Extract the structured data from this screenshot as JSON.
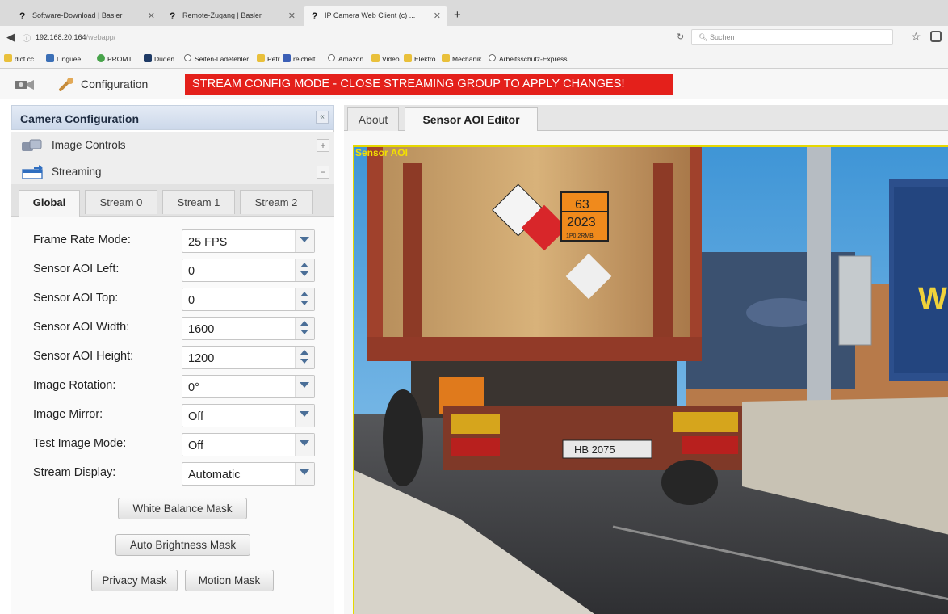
{
  "browser": {
    "tabs": [
      {
        "label": "Software-Download | Basler",
        "active": false
      },
      {
        "label": "Remote-Zugang | Basler",
        "active": false
      },
      {
        "label": "IP Camera Web Client (c) ...",
        "active": true
      }
    ],
    "new_tab": "+",
    "url_host": "192.168.20.164",
    "url_path": "/webapp/",
    "search_placeholder": "Suchen",
    "bookmarks": [
      "dict.cc",
      "Linguee",
      "PROMT",
      "Duden",
      "Seiten-Ladefehler",
      "Petr",
      "reichelt",
      "Amazon",
      "Video",
      "Elektro",
      "Mechanik",
      "Arbeitsschutz-Express"
    ]
  },
  "app": {
    "config_label": "Configuration",
    "banner": "STREAM CONFIG MODE - CLOSE STREAMING GROUP TO APPLY CHANGES!",
    "banner_color": "#e4201b"
  },
  "left_panel": {
    "title": "Camera Configuration",
    "collapse_glyph": "«",
    "sections": [
      {
        "label": "Image Controls",
        "toggle": "+"
      },
      {
        "label": "Streaming",
        "toggle": "−"
      }
    ],
    "tabs": [
      "Global",
      "Stream 0",
      "Stream 1",
      "Stream 2"
    ],
    "active_tab": "Global",
    "fields": [
      {
        "label": "Frame Rate Mode:",
        "value": "25 FPS",
        "control": "select"
      },
      {
        "label": "Sensor AOI Left:",
        "value": "0",
        "control": "spinner"
      },
      {
        "label": "Sensor AOI Top:",
        "value": "0",
        "control": "spinner"
      },
      {
        "label": "Sensor AOI Width:",
        "value": "1600",
        "control": "spinner"
      },
      {
        "label": "Sensor AOI Height:",
        "value": "1200",
        "control": "spinner"
      },
      {
        "label": "Image Rotation:",
        "value": "0°",
        "control": "select"
      },
      {
        "label": "Image Mirror:",
        "value": "Off",
        "control": "select"
      },
      {
        "label": "Test Image Mode:",
        "value": "Off",
        "control": "select"
      },
      {
        "label": "Stream Display:",
        "value": "Automatic",
        "control": "select"
      }
    ],
    "buttons": {
      "white_balance": "White Balance Mask",
      "auto_brightness": "Auto Brightness Mask",
      "privacy": "Privacy Mask",
      "motion": "Motion Mask"
    }
  },
  "right_panel": {
    "tabs": [
      "About",
      "Sensor AOI Editor"
    ],
    "active_tab": "Sensor AOI Editor",
    "aoi_label": "Sensor AOI",
    "aoi_color": "#e6d800",
    "placard_number_top": "63",
    "placard_number_bottom": "2023",
    "placard_small": "1P0 2RMB",
    "license_plate": "HB 2075",
    "trailer_text": "W"
  }
}
